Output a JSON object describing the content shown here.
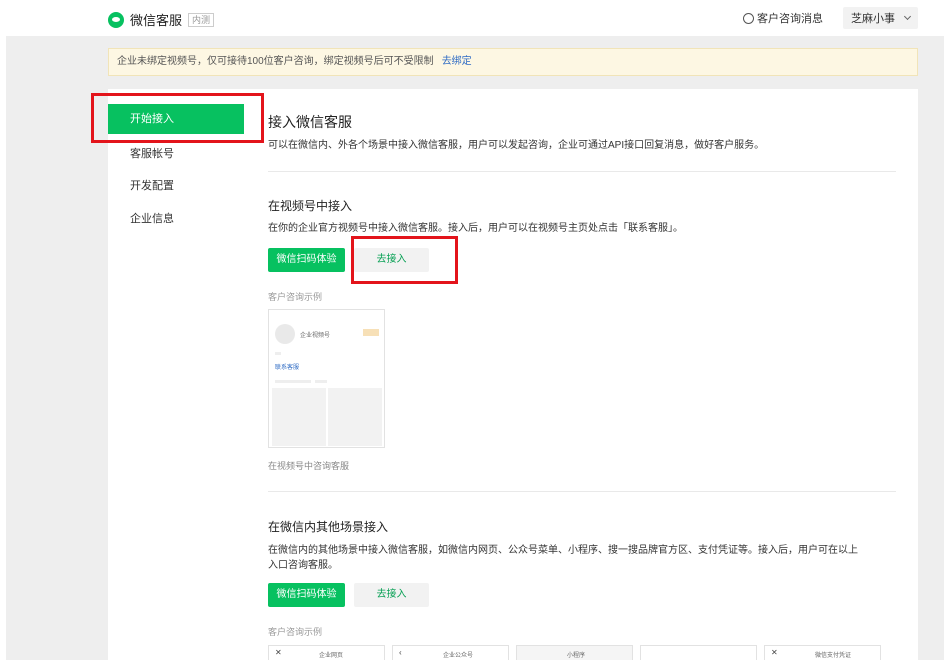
{
  "header": {
    "title": "微信客服",
    "badge": "内测",
    "messages_label": "客户咨询消息",
    "account_name": "芝麻小事"
  },
  "notice": {
    "text": "企业未绑定视频号，仅可接待100位客户咨询，绑定视频号后可不受限制",
    "link": "去绑定"
  },
  "sidebar": {
    "items": [
      {
        "label": "开始接入",
        "active": true
      },
      {
        "label": "客服帐号",
        "active": false
      },
      {
        "label": "开发配置",
        "active": false
      },
      {
        "label": "企业信息",
        "active": false
      }
    ]
  },
  "main": {
    "title": "接入微信客服",
    "description": "可以在微信内、外各个场景中接入微信客服，用户可以发起咨询，企业可通过API接口回复消息，做好客户服务。",
    "sections": [
      {
        "title": "在视频号中接入",
        "description": "在你的企业官方视频号中接入微信客服。接入后，用户可以在视频号主页处点击「联系客服」。",
        "scan_button": "微信扫码体验",
        "connect_button": "去接入",
        "example_label": "客户咨询示例",
        "caption": "在视频号中咨询客服",
        "preview": {
          "account": "企业视频号",
          "contact_link": "联系客服"
        }
      },
      {
        "title": "在微信内其他场景接入",
        "description_line1": "在微信内的其他场景中接入微信客服，如微信内网页、公众号菜单、小程序、搜一搜品牌官方区、支付凭证等。接入后，用户可在以上",
        "description_line2": "入口咨询客服。",
        "scan_button": "微信扫码体验",
        "connect_button": "去接入",
        "example_label": "客户咨询示例",
        "thumbs": [
          "企业网页",
          "企业公众号",
          "小程序",
          "",
          "微信支付凭证"
        ]
      }
    ]
  },
  "colors": {
    "accent": "#07c160",
    "highlight": "#e3141b",
    "notice_bg": "#fdf7e3",
    "link": "#2e6bc4"
  },
  "icons": [
    "wechat-logo-icon",
    "chat-bubble-icon",
    "chevron-down-icon",
    "close-icon"
  ]
}
